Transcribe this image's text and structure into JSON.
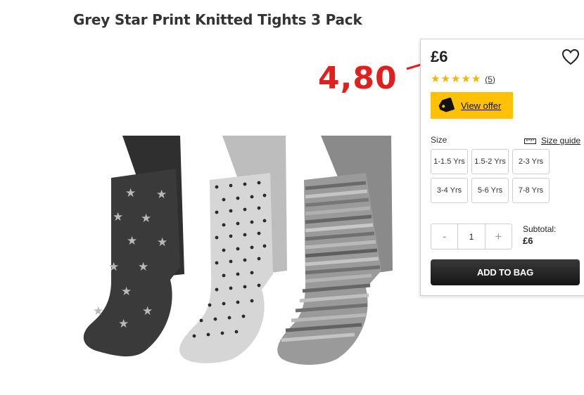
{
  "product": {
    "title": "Grey Star Print Knitted Tights 3 Pack"
  },
  "annotation": {
    "new_price": "4,80",
    "color": "#e0201c"
  },
  "panel": {
    "old_price": "£6",
    "rating": 5,
    "review_count": "(5)",
    "offer_label": "View offer",
    "size_label": "Size",
    "size_guide_label": "Size guide",
    "sizes": [
      "1-1.5 Yrs",
      "1.5-2 Yrs",
      "2-3 Yrs",
      "3-4 Yrs",
      "5-6 Yrs",
      "7-8 Yrs"
    ],
    "quantity": {
      "minus": "-",
      "value": "1",
      "plus": "+"
    },
    "subtotal_label": "Subtotal:",
    "subtotal_value": "£6",
    "add_to_bag_label": "ADD TO BAG"
  },
  "colors": {
    "offer_button": "#ffc107",
    "star": "#f5b400",
    "add_button": "#1e1e1e"
  },
  "icons": {
    "wishlist": "heart-icon",
    "offer": "tag-icon",
    "size_guide": "ruler-icon",
    "rating": "star-icon"
  }
}
